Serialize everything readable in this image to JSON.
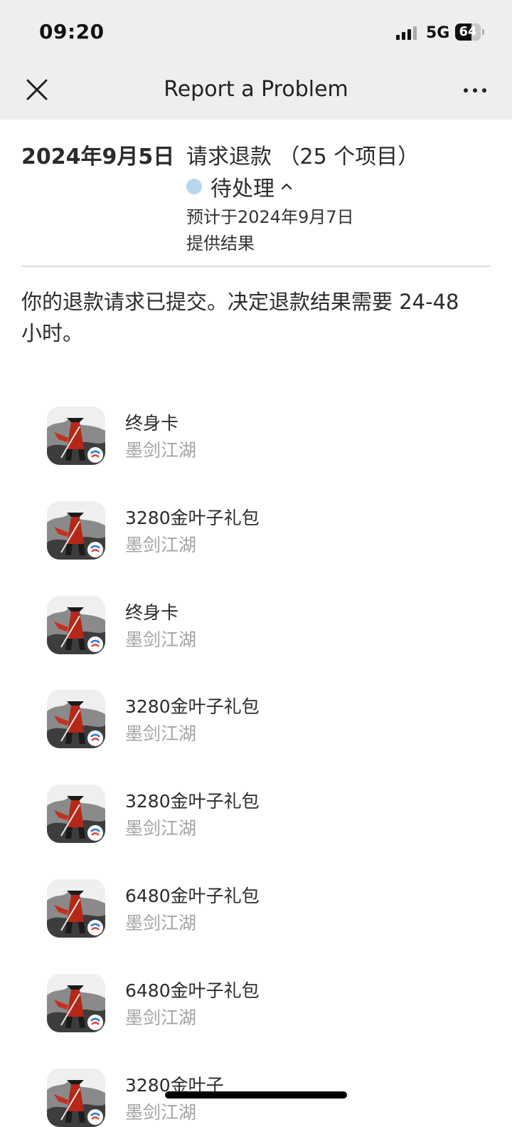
{
  "status_bar": {
    "time": "09:20",
    "network": "5G",
    "battery": "64",
    "battery_level": 0.64
  },
  "nav": {
    "title": "Report a Problem",
    "close_icon": "close-icon",
    "more_icon": "more-icon"
  },
  "request": {
    "date": "2024年9月5日",
    "title": "请求退款 （25 个项目）",
    "status": "待处理",
    "status_color": "#b9d6ef",
    "expected_line1": "预计于2024年9月7日",
    "expected_line2": "提供结果",
    "message": "你的退款请求已提交。决定退款结果需要 24-48 小时。"
  },
  "items": [
    {
      "name": "终身卡",
      "app": "墨剑江湖"
    },
    {
      "name": "3280金叶子礼包",
      "app": "墨剑江湖"
    },
    {
      "name": "终身卡",
      "app": "墨剑江湖"
    },
    {
      "name": "3280金叶子礼包",
      "app": "墨剑江湖"
    },
    {
      "name": "3280金叶子礼包",
      "app": "墨剑江湖"
    },
    {
      "name": "6480金叶子礼包",
      "app": "墨剑江湖"
    },
    {
      "name": "6480金叶子礼包",
      "app": "墨剑江湖"
    },
    {
      "name": "3280金叶子",
      "app": "墨剑江湖"
    }
  ]
}
